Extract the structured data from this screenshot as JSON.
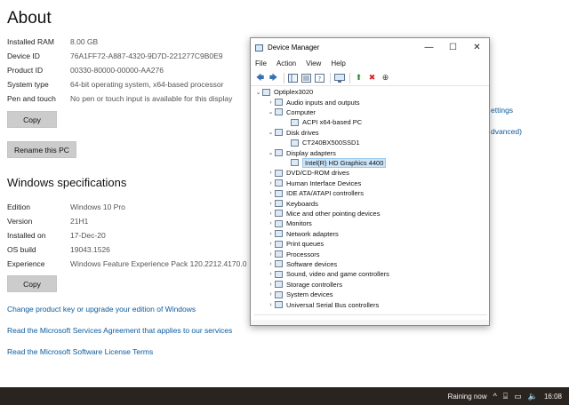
{
  "settings": {
    "title": "About",
    "device_specs": [
      {
        "key": "Installed RAM",
        "value": "8.00 GB"
      },
      {
        "key": "Device ID",
        "value": "76A1FF72-A887-4320-9D7D-221277C9B0E9"
      },
      {
        "key": "Product ID",
        "value": "00330-80000-00000-AA276"
      },
      {
        "key": "System type",
        "value": "64-bit operating system, x64-based processor"
      },
      {
        "key": "Pen and touch",
        "value": "No pen or touch input is available for this display"
      }
    ],
    "copy_label": "Copy",
    "rename_label": "Rename this PC",
    "windows_title": "Windows specifications",
    "windows_specs": [
      {
        "key": "Edition",
        "value": "Windows 10 Pro"
      },
      {
        "key": "Version",
        "value": "21H1"
      },
      {
        "key": "Installed on",
        "value": "17-Dec-20"
      },
      {
        "key": "OS build",
        "value": "19043.1526"
      },
      {
        "key": "Experience",
        "value": "Windows Feature Experience Pack 120.2212.4170.0"
      }
    ],
    "copy2_label": "Copy",
    "links": [
      "Change product key or upgrade your edition of Windows",
      "Read the Microsoft Services Agreement that applies to our services",
      "Read the Microsoft Software License Terms"
    ],
    "side_links": [
      "ettings",
      "dvanced)"
    ]
  },
  "device_manager": {
    "title": "Device Manager",
    "menu": [
      "File",
      "Action",
      "View",
      "Help"
    ],
    "tree": [
      {
        "label": "Optiplex3020",
        "level": 0,
        "expander": "⌄",
        "selected": false
      },
      {
        "label": "Audio inputs and outputs",
        "level": 1,
        "expander": "›",
        "selected": false
      },
      {
        "label": "Computer",
        "level": 1,
        "expander": "⌄",
        "selected": false
      },
      {
        "label": "ACPI x64-based PC",
        "level": 2,
        "expander": "",
        "selected": false
      },
      {
        "label": "Disk drives",
        "level": 1,
        "expander": "⌄",
        "selected": false
      },
      {
        "label": "CT240BX500SSD1",
        "level": 2,
        "expander": "",
        "selected": false
      },
      {
        "label": "Display adapters",
        "level": 1,
        "expander": "⌄",
        "selected": false
      },
      {
        "label": "Intel(R) HD Graphics 4400",
        "level": 2,
        "expander": "",
        "selected": true
      },
      {
        "label": "DVD/CD-ROM drives",
        "level": 1,
        "expander": "›",
        "selected": false
      },
      {
        "label": "Human Interface Devices",
        "level": 1,
        "expander": "›",
        "selected": false
      },
      {
        "label": "IDE ATA/ATAPI controllers",
        "level": 1,
        "expander": "›",
        "selected": false
      },
      {
        "label": "Keyboards",
        "level": 1,
        "expander": "›",
        "selected": false
      },
      {
        "label": "Mice and other pointing devices",
        "level": 1,
        "expander": "›",
        "selected": false
      },
      {
        "label": "Monitors",
        "level": 1,
        "expander": "›",
        "selected": false
      },
      {
        "label": "Network adapters",
        "level": 1,
        "expander": "›",
        "selected": false
      },
      {
        "label": "Print queues",
        "level": 1,
        "expander": "›",
        "selected": false
      },
      {
        "label": "Processors",
        "level": 1,
        "expander": "›",
        "selected": false
      },
      {
        "label": "Software devices",
        "level": 1,
        "expander": "›",
        "selected": false
      },
      {
        "label": "Sound, video and game controllers",
        "level": 1,
        "expander": "›",
        "selected": false
      },
      {
        "label": "Storage controllers",
        "level": 1,
        "expander": "›",
        "selected": false
      },
      {
        "label": "System devices",
        "level": 1,
        "expander": "›",
        "selected": false
      },
      {
        "label": "Universal Serial Bus controllers",
        "level": 1,
        "expander": "›",
        "selected": false
      }
    ]
  },
  "taskbar": {
    "weather": "Raining now",
    "time": "16:08"
  },
  "colors": {
    "link": "#0a5a9c",
    "selection": "#cce4f7",
    "taskbar": "#2a2420",
    "button": "#cccccc"
  }
}
